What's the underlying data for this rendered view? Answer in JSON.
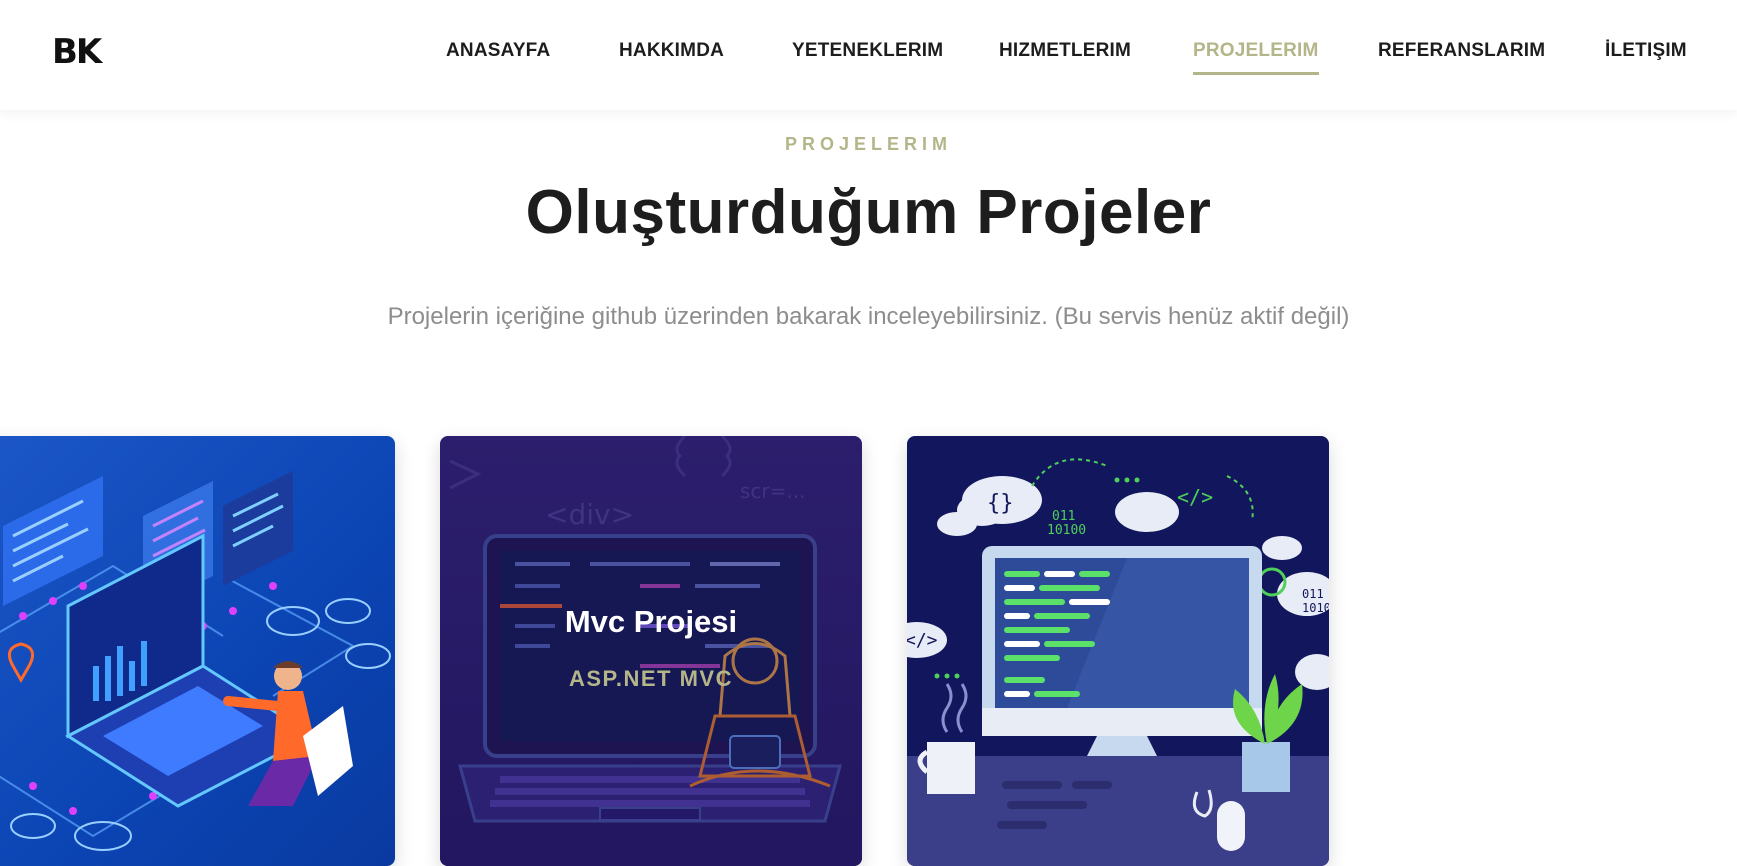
{
  "header": {
    "logo": "BK",
    "nav": [
      {
        "label": "ANASAYFA",
        "active": false
      },
      {
        "label": "HAKKIMDA",
        "active": false
      },
      {
        "label": "YETENEKLERIM",
        "active": false
      },
      {
        "label": "HIZMETLERIM",
        "active": false
      },
      {
        "label": "PROJELERIM",
        "active": true
      },
      {
        "label": "REFERANSLARIM",
        "active": false
      },
      {
        "label": "İLETIŞIM",
        "active": false
      }
    ]
  },
  "section": {
    "kicker": "PROJELERIM",
    "title": "Oluşturduğum Projeler",
    "subtitle": "Projelerin içeriğine github üzerinden bakarak inceleyebilirsiniz. (Bu servis henüz aktif değil)"
  },
  "projects": [
    {
      "title": "",
      "tag": "",
      "image": "isometric-developer-laptop-illustration"
    },
    {
      "title": "Mvc Projesi",
      "tag": "ASP.NET MVC",
      "image": "developer-with-laptop-code-illustration"
    },
    {
      "title": "",
      "tag": "",
      "image": "desktop-monitor-cloud-code-illustration"
    }
  ],
  "colors": {
    "accent": "#b5b58a",
    "text_dark": "#1d1d1d",
    "text_muted": "#8d8d8d"
  }
}
